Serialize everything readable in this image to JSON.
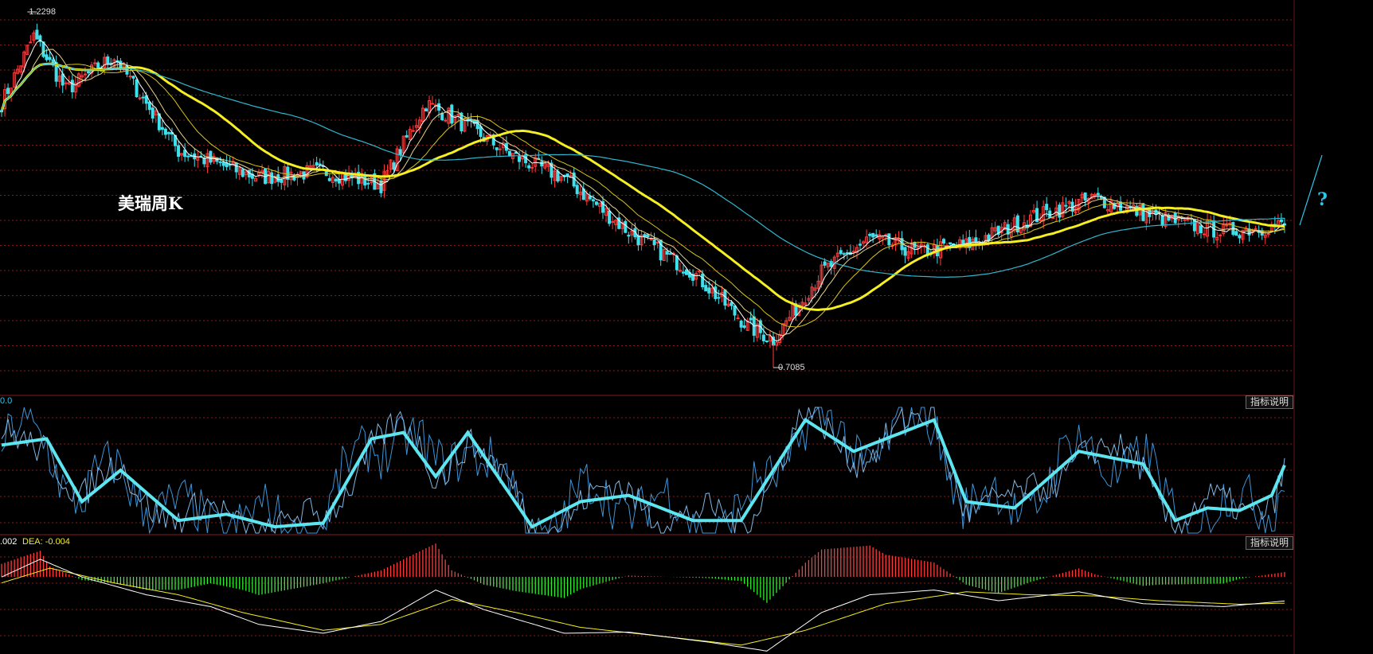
{
  "title": "美瑞周K",
  "price_panel": {
    "high_label": "1.2298",
    "low_label": "0.7085",
    "question_mark": "?"
  },
  "indicator_panel": {
    "left_value": "0.0",
    "button_label": "指标说明"
  },
  "macd_panel": {
    "left_label": ".002",
    "dea_label": "DEA: -0.004",
    "button_label": "指标说明"
  },
  "colors": {
    "up": "#ff3b3b",
    "down": "#3fe0ec",
    "ma_main": "#f4ee22",
    "ma_long": "#2fb7cf",
    "grid": "#8a1a1a",
    "kdj_main": "#5ee6f0",
    "kdj_thin": "#3b95d8",
    "dif": "#ffffff",
    "dea": "#f4ee22",
    "hist_up": "#ff3b3b",
    "hist_down": "#2ef02e"
  },
  "chart_data": [
    {
      "type": "candlestick",
      "name": "美瑞周K",
      "y_high": 1.2298,
      "y_low": 0.7085,
      "keypoints_close": [
        [
          0,
          1.1
        ],
        [
          10,
          1.2
        ],
        [
          20,
          1.12
        ],
        [
          35,
          1.17
        ],
        [
          55,
          1.03
        ],
        [
          80,
          0.99
        ],
        [
          100,
          1.0
        ],
        [
          118,
          0.98
        ],
        [
          132,
          1.1
        ],
        [
          140,
          1.08
        ],
        [
          160,
          1.02
        ],
        [
          175,
          0.99
        ],
        [
          195,
          0.91
        ],
        [
          215,
          0.85
        ],
        [
          232,
          0.77
        ],
        [
          240,
          0.75
        ],
        [
          255,
          0.85
        ],
        [
          270,
          0.9
        ],
        [
          285,
          0.88
        ],
        [
          300,
          0.89
        ],
        [
          320,
          0.93
        ],
        [
          340,
          0.96
        ],
        [
          360,
          0.93
        ],
        [
          380,
          0.91
        ],
        [
          400,
          0.92
        ]
      ]
    },
    {
      "type": "line",
      "name": "oscillator",
      "ylim": [
        0,
        100
      ],
      "keypoints": [
        [
          0,
          70
        ],
        [
          14,
          75
        ],
        [
          25,
          25
        ],
        [
          37,
          50
        ],
        [
          55,
          10
        ],
        [
          70,
          15
        ],
        [
          85,
          5
        ],
        [
          100,
          8
        ],
        [
          115,
          75
        ],
        [
          125,
          80
        ],
        [
          135,
          45
        ],
        [
          145,
          80
        ],
        [
          165,
          5
        ],
        [
          180,
          25
        ],
        [
          195,
          30
        ],
        [
          215,
          10
        ],
        [
          230,
          10
        ],
        [
          250,
          90
        ],
        [
          265,
          65
        ],
        [
          290,
          90
        ],
        [
          300,
          25
        ],
        [
          315,
          20
        ],
        [
          335,
          65
        ],
        [
          355,
          55
        ],
        [
          365,
          10
        ],
        [
          375,
          20
        ],
        [
          385,
          18
        ],
        [
          395,
          30
        ],
        [
          400,
          60
        ]
      ]
    },
    {
      "type": "line",
      "name": "MACD",
      "ylim": [
        -0.09,
        0.09
      ],
      "keypoints_dif": [
        [
          0,
          0.04
        ],
        [
          12,
          0.07
        ],
        [
          25,
          0.04
        ],
        [
          45,
          0.01
        ],
        [
          65,
          -0.01
        ],
        [
          80,
          -0.04
        ],
        [
          100,
          -0.055
        ],
        [
          118,
          -0.035
        ],
        [
          135,
          0.018
        ],
        [
          150,
          -0.015
        ],
        [
          175,
          -0.055
        ],
        [
          195,
          -0.053
        ],
        [
          220,
          -0.07
        ],
        [
          238,
          -0.085
        ],
        [
          255,
          -0.02
        ],
        [
          270,
          0.01
        ],
        [
          290,
          0.018
        ],
        [
          310,
          0.0
        ],
        [
          335,
          0.015
        ],
        [
          355,
          -0.005
        ],
        [
          380,
          -0.01
        ],
        [
          400,
          0.0
        ]
      ],
      "keypoints_dea": [
        [
          0,
          0.03
        ],
        [
          15,
          0.055
        ],
        [
          35,
          0.03
        ],
        [
          55,
          0.01
        ],
        [
          75,
          -0.02
        ],
        [
          100,
          -0.05
        ],
        [
          118,
          -0.04
        ],
        [
          140,
          0.002
        ],
        [
          160,
          -0.02
        ],
        [
          180,
          -0.045
        ],
        [
          205,
          -0.06
        ],
        [
          230,
          -0.075
        ],
        [
          250,
          -0.05
        ],
        [
          275,
          -0.005
        ],
        [
          300,
          0.015
        ],
        [
          320,
          0.01
        ],
        [
          340,
          0.008
        ],
        [
          360,
          0.0
        ],
        [
          385,
          -0.006
        ],
        [
          400,
          -0.004
        ]
      ]
    }
  ]
}
